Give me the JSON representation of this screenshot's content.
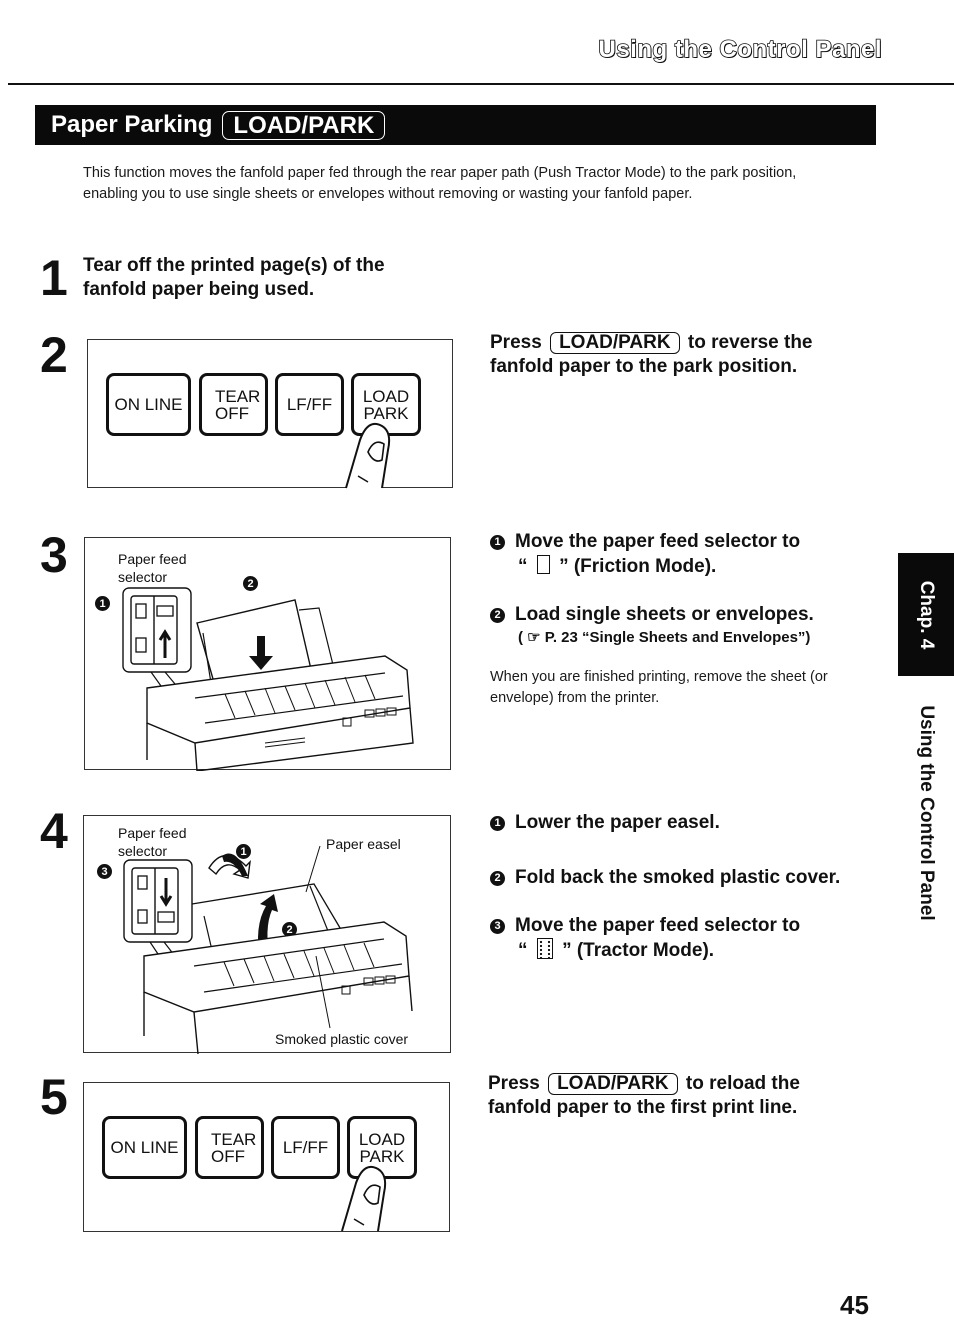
{
  "running_head": "Using the Control Panel",
  "section": {
    "title": "Paper Parking",
    "title_key": "LOAD/PARK"
  },
  "intro": "This function moves the fanfold paper fed through the rear paper path (Push Tractor Mode) to the park position, enabling you to use single sheets or envelopes without removing or wasting your fanfold paper.",
  "steps": [
    {
      "number": "1",
      "heading_line1": "Tear off the printed page(s) of the",
      "heading_line2": "fanfold paper being used."
    },
    {
      "number": "2",
      "panel_keys": [
        {
          "line1": "ON LINE",
          "line2": ""
        },
        {
          "line1": "TEAR",
          "line2": "OFF"
        },
        {
          "line1": "LF/FF",
          "line2": ""
        },
        {
          "line1": "LOAD",
          "line2": "PARK"
        }
      ],
      "text_prefix": "Press",
      "text_key": "LOAD/PARK",
      "text_suffix": "to reverse the",
      "text_line2": "fanfold paper to the park position."
    },
    {
      "number": "3",
      "figure_labels": {
        "selector_line1": "Paper feed",
        "selector_line2": "selector",
        "callout_1": "1",
        "callout_2": "2"
      },
      "items": [
        {
          "marker": "1",
          "line1": "Move the paper feed selector to",
          "line2_open": "“",
          "line2_close": "” (Friction Mode).",
          "icon": "friction-mode-icon"
        },
        {
          "marker": "2",
          "line1": "Load single sheets or envelopes.",
          "ref": "( ☞ P. 23 “Single Sheets and Envelopes”)"
        }
      ],
      "note": "When you are finished printing, remove the sheet (or envelope) from the printer."
    },
    {
      "number": "4",
      "figure_labels": {
        "selector_line1": "Paper feed",
        "selector_line2": "selector",
        "paper_easel": "Paper easel",
        "smoked_cover": "Smoked plastic cover",
        "callout_1": "1",
        "callout_2": "2",
        "callout_3": "3"
      },
      "items": [
        {
          "marker": "1",
          "line1": "Lower the paper easel."
        },
        {
          "marker": "2",
          "line1": "Fold back the smoked plastic cover."
        },
        {
          "marker": "3",
          "line1": "Move the paper feed selector to",
          "line2_open": "“",
          "line2_close": "” (Tractor Mode).",
          "icon": "tractor-mode-icon"
        }
      ]
    },
    {
      "number": "5",
      "panel_keys": [
        {
          "line1": "ON LINE",
          "line2": ""
        },
        {
          "line1": "TEAR",
          "line2": "OFF"
        },
        {
          "line1": "LF/FF",
          "line2": ""
        },
        {
          "line1": "LOAD",
          "line2": "PARK"
        }
      ],
      "text_prefix": "Press",
      "text_key": "LOAD/PARK",
      "text_suffix": "to reload the",
      "text_line2": "fanfold paper to the first print line."
    }
  ],
  "chapter_tab": "Chap. 4",
  "side_title": "Using the Control Panel",
  "page_number": "45"
}
